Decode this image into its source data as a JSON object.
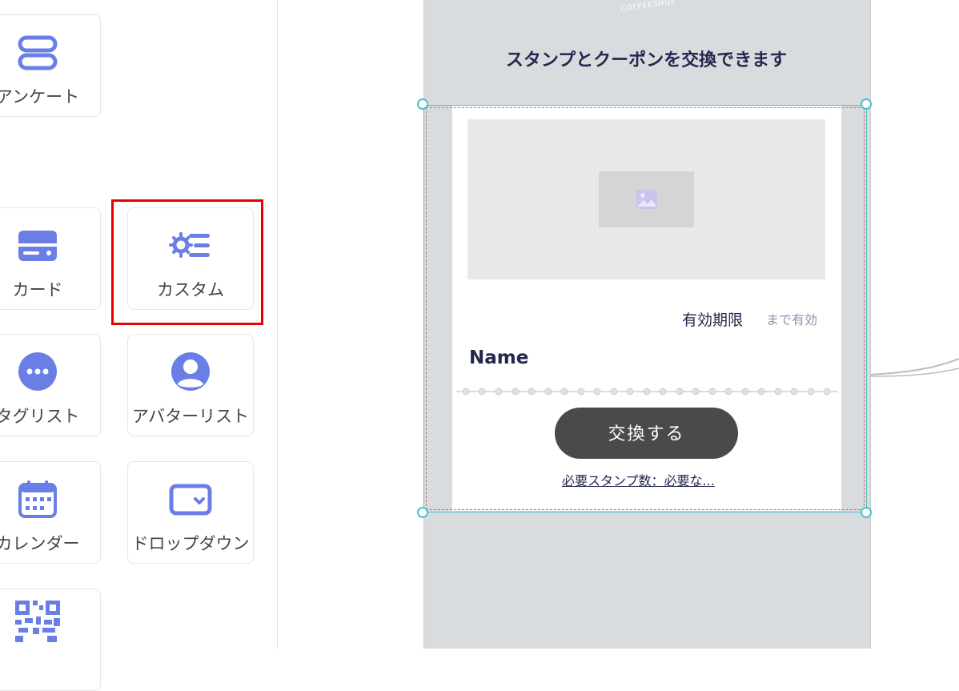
{
  "palette": {
    "items": [
      {
        "label": "アンケート",
        "icon": "survey-icon"
      },
      {
        "label": "カード",
        "icon": "card-icon"
      },
      {
        "label": "カスタム",
        "icon": "custom-settings-icon"
      },
      {
        "label": "タグリスト",
        "icon": "tag-list-icon"
      },
      {
        "label": "アバターリスト",
        "icon": "avatar-list-icon"
      },
      {
        "label": "カレンダー",
        "icon": "calendar-icon"
      },
      {
        "label": "ドロップダウン",
        "icon": "dropdown-icon"
      },
      {
        "label": "",
        "icon": "qr-code-icon"
      }
    ],
    "accent_color": "#6a7fe6",
    "highlight_color": "#e60000"
  },
  "preview": {
    "logo_text": "COFFEESHOP",
    "headline": "スタンプとクーポンを交換できます",
    "coupon": {
      "expiry_label": "有効期限",
      "expiry_suffix": "まで有効",
      "name": "Name",
      "exchange_button": "交換する",
      "required_stamps_link": "必要スタンプ数：必要な..."
    },
    "selection_color": "#4bbfd0"
  }
}
